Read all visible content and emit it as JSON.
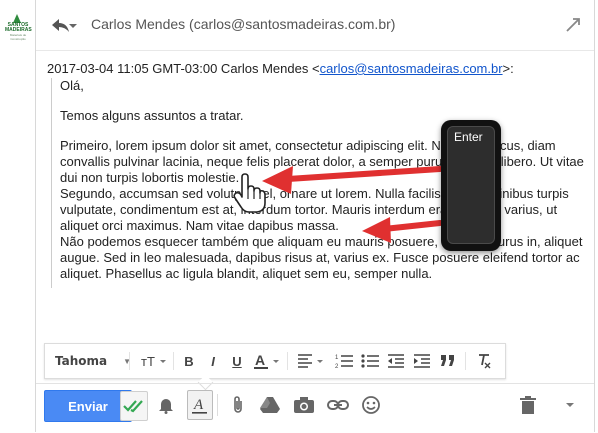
{
  "logo": {
    "line1": "SANTOS",
    "line2": "MADEIRAS",
    "line3": "Materiais de Construção"
  },
  "header": {
    "recipient": "Carlos Mendes (carlos@santosmadeiras.com.br)"
  },
  "quote": {
    "date": "2017-03-04 11:05 GMT-03:00 Carlos Mendes <",
    "email": "carlos@santosmadeiras.com.br",
    "suffix": ">:",
    "greeting": "Olá,",
    "line1": "Temos alguns assuntos a tratar.",
    "para1": "Primeiro, lorem ipsum dolor sit amet, consectetur adipiscing elit. Nam quis lacus, diam convallis pulvinar lacinia, neque felis placerat dolor, a semper purus tellus ut libero. Ut vitae dui non turpis lobortis molestie.",
    "para2": "Segundo, accumsan sed volutpat vel, ornare ut lorem. Nulla facilisi. Nam in finibus turpis vulputate, condimentum est at, interdum tortor. Mauris interdum erat vel urna varius, ut aliquet orci maximus. Nam vitae dapibus massa.",
    "para3": "Não podemos esquecer também que aliquam eu mauris posuere, eleifend purus in, aliquet augue. Sed in leo malesuada, dapibus risus at, varius ex. Fusce posuere eleifend tortor ac aliquet. Phasellus ac ligula blandit, aliquet sem eu, semper nulla."
  },
  "format_bar": {
    "font": "Tahoma"
  },
  "footer": {
    "send_label": "Enviar"
  },
  "overlay": {
    "key_label": "Enter"
  },
  "colors": {
    "accent": "#4a8af4",
    "link": "#1155cc",
    "annotation": "#e03030"
  }
}
